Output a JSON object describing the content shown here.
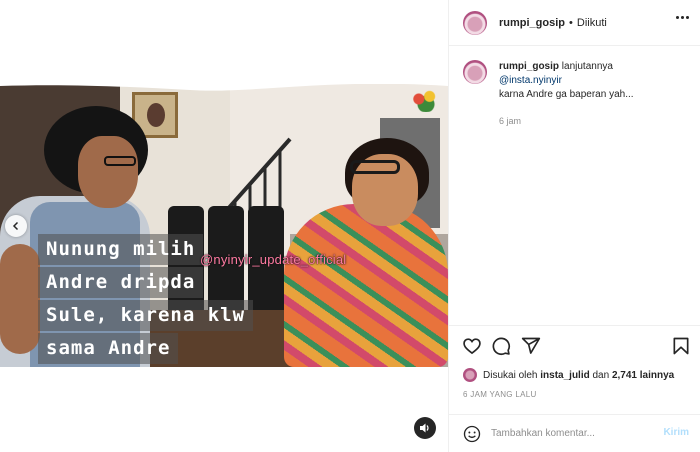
{
  "header": {
    "username": "rumpi_gosip",
    "separator": "•",
    "follow_label": "Diikuti"
  },
  "media": {
    "caption_lines": [
      "Nunung milih",
      "Andre dripda",
      "Sule, karena klw",
      "sama Andre"
    ],
    "watermark": "@nyinyir_update_official"
  },
  "comment": {
    "username": "rumpi_gosip",
    "text_1": "lanjutannya",
    "mention": "@insta.nyinyir",
    "text_2": "karna Andre ga baperan yah...",
    "time": "6 jam"
  },
  "likes": {
    "prefix": "Disukai oleh",
    "liker": "insta_julid",
    "joiner": "dan",
    "count": "2,741 lainnya"
  },
  "posted_ago": "6 JAM YANG LALU",
  "add_comment": {
    "placeholder": "Tambahkan komentar...",
    "submit_label": "Kirim"
  },
  "icons": [
    "chevron-left-icon",
    "speaker-icon",
    "heart-icon",
    "comment-icon",
    "share-icon",
    "bookmark-icon",
    "emoji-icon",
    "more-icon"
  ]
}
